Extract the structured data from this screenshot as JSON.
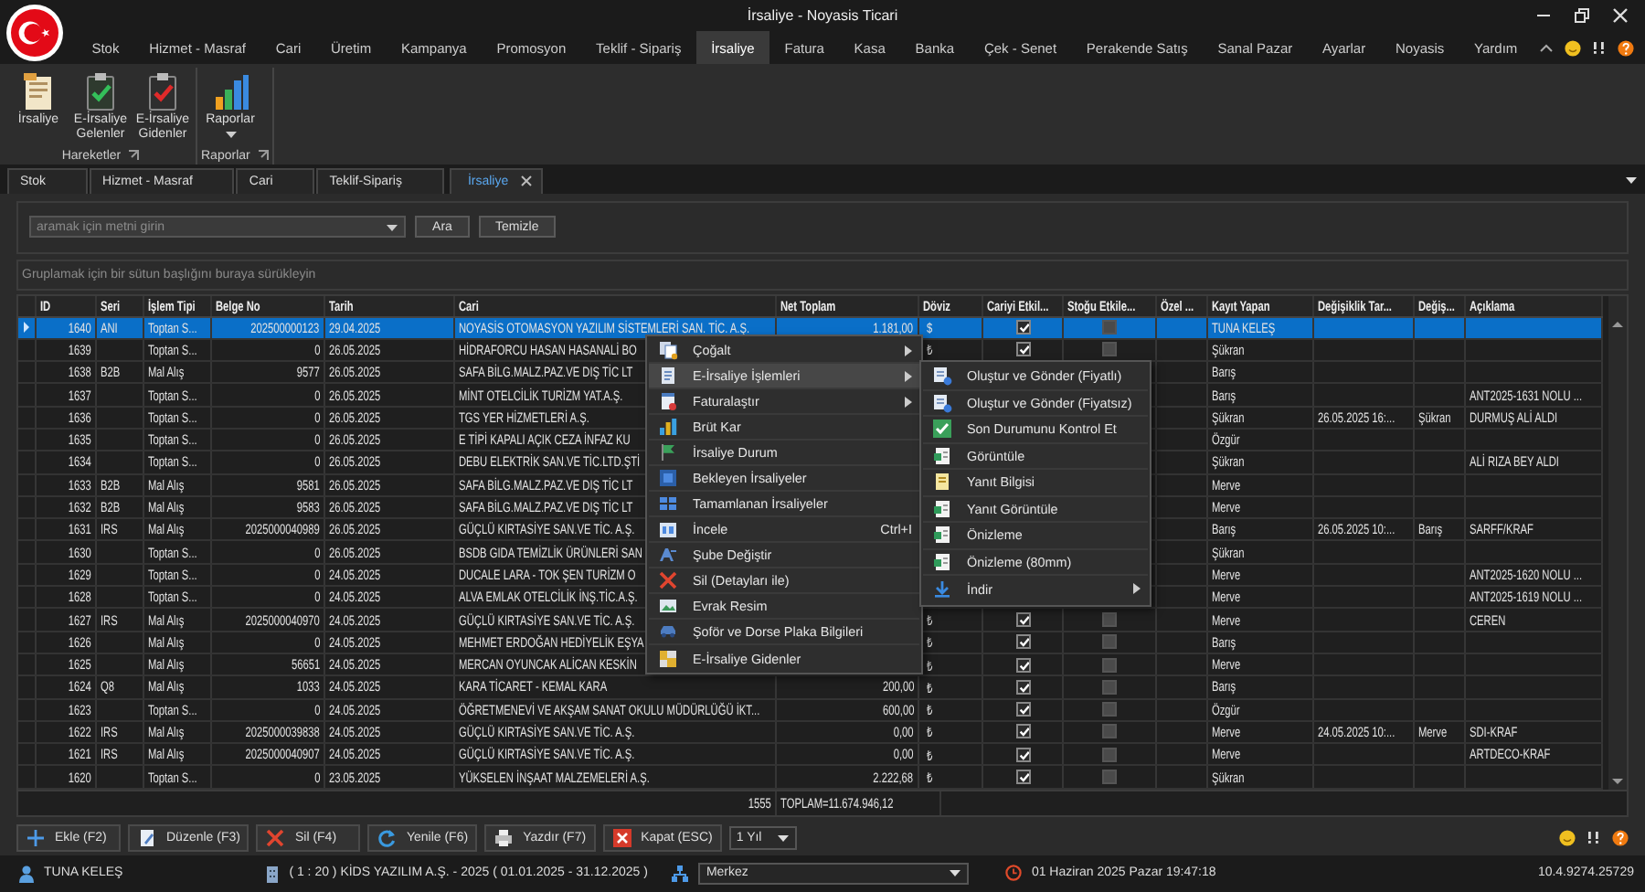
{
  "window": {
    "title": "İrsaliye - Noyasis Ticari"
  },
  "menu_tabs": [
    {
      "label": "Stok",
      "selected": false
    },
    {
      "label": "Hizmet - Masraf",
      "selected": false
    },
    {
      "label": "Cari",
      "selected": false
    },
    {
      "label": "Üretim",
      "selected": false
    },
    {
      "label": "Kampanya",
      "selected": false
    },
    {
      "label": "Promosyon",
      "selected": false
    },
    {
      "label": "Teklif - Sipariş",
      "selected": false
    },
    {
      "label": "İrsaliye",
      "selected": true
    },
    {
      "label": "Fatura",
      "selected": false
    },
    {
      "label": "Kasa",
      "selected": false
    },
    {
      "label": "Banka",
      "selected": false
    },
    {
      "label": "Çek - Senet",
      "selected": false
    },
    {
      "label": "Perakende Satış",
      "selected": false
    },
    {
      "label": "Sanal Pazar",
      "selected": false
    },
    {
      "label": "Ayarlar",
      "selected": false
    },
    {
      "label": "Noyasis",
      "selected": false
    },
    {
      "label": "Yardım",
      "selected": false
    }
  ],
  "ribbon": {
    "groups": [
      {
        "label": "Hareketler",
        "buttons": [
          {
            "label": "İrsaliye",
            "dropdown": false
          },
          {
            "label": "E-İrsaliye Gelenler",
            "dropdown": false
          },
          {
            "label": "E-İrsaliye Gidenler",
            "dropdown": false
          }
        ]
      },
      {
        "label": "Raporlar",
        "buttons": [
          {
            "label": "Raporlar",
            "dropdown": true
          }
        ]
      }
    ]
  },
  "doc_tabs": [
    {
      "label": "Stok",
      "selected": false,
      "closable": false
    },
    {
      "label": "Hizmet - Masraf",
      "selected": false,
      "closable": false
    },
    {
      "label": "Cari",
      "selected": false,
      "closable": false
    },
    {
      "label": "Teklif-Sipariş",
      "selected": false,
      "closable": false
    },
    {
      "label": "İrsaliye",
      "selected": true,
      "closable": true
    }
  ],
  "search": {
    "placeholder": "aramak için metni girin",
    "buttons": [
      "Ara",
      "Temizle"
    ]
  },
  "group_hint": "Gruplamak için bir sütun başlığını buraya sürükleyin",
  "grid": {
    "columns": [
      "ID",
      "Seri",
      "İşlem Tipi",
      "Belge No",
      "Tarih",
      "Cari",
      "Net Toplam",
      "Döviz",
      "Cariyi Etkil...",
      "Stoğu Etkile...",
      "Özel ...",
      "Kayıt Yapan",
      "Değişiklik Tar...",
      "Değiş...",
      "Açıklama"
    ],
    "rows": [
      {
        "selected": true,
        "id": "1640",
        "seri": "ANI",
        "islem_tipi": "Toptan S...",
        "belge_no": "202500000123",
        "tarih": "29.04.2025",
        "cari": "NOYASİS OTOMASYON YAZILIM SİSTEMLERİ SAN. TİC. A.Ş.",
        "net_toplam": "1.181,00",
        "doviz": "$",
        "cariyi_etkiler": true,
        "stogu_etkiler": false,
        "kayit_yapan": "TUNA KELEŞ"
      },
      {
        "selected": false,
        "id": "1639",
        "islem_tipi": "Toptan S...",
        "belge_no": "0",
        "tarih": "26.05.2025",
        "cari": "HİDRAFORCU HASAN HASANALİ BO",
        "doviz": "₺",
        "cariyi_etkiler": true,
        "stogu_etkiler": false,
        "kayit_yapan": "Şükran"
      },
      {
        "selected": false,
        "id": "1638",
        "seri": "B2B",
        "islem_tipi": "Mal Alış",
        "belge_no": "9577",
        "tarih": "26.05.2025",
        "cari": "SAFA BİLG.MALZ.PAZ.VE DIŞ TİC LT",
        "kayit_yapan": "Barış"
      },
      {
        "selected": false,
        "id": "1637",
        "islem_tipi": "Toptan S...",
        "belge_no": "0",
        "tarih": "26.05.2025",
        "cari": "MİNT OTELCİLİK TURİZM YAT.A.Ş.",
        "kayit_yapan": "Barış",
        "aciklama": "ANT2025-1631 NOLU ..."
      },
      {
        "selected": false,
        "id": "1636",
        "islem_tipi": "Toptan S...",
        "belge_no": "0",
        "tarih": "26.05.2025",
        "cari": "TGS YER HİZMETLERİ A.Ş.",
        "kayit_yapan": "Şükran",
        "degisiklik_tarihi": "26.05.2025 16:...",
        "degistiren": "Şükran",
        "aciklama": "DURMUŞ ALİ ALDI"
      },
      {
        "selected": false,
        "id": "1635",
        "islem_tipi": "Toptan S...",
        "belge_no": "0",
        "tarih": "26.05.2025",
        "cari": "E TİPİ KAPALI AÇIK CEZA İNFAZ KU",
        "kayit_yapan": "Özgür"
      },
      {
        "selected": false,
        "id": "1634",
        "islem_tipi": "Toptan S...",
        "belge_no": "0",
        "tarih": "26.05.2025",
        "cari": "DEBU ELEKTRİK SAN.VE TİC.LTD.ŞTİ",
        "kayit_yapan": "Şükran",
        "aciklama": "ALİ RIZA BEY ALDI"
      },
      {
        "selected": false,
        "id": "1633",
        "seri": "B2B",
        "islem_tipi": "Mal Alış",
        "belge_no": "9581",
        "tarih": "26.05.2025",
        "cari": "SAFA BİLG.MALZ.PAZ.VE DIŞ TİC LT",
        "kayit_yapan": "Merve"
      },
      {
        "selected": false,
        "id": "1632",
        "seri": "B2B",
        "islem_tipi": "Mal Alış",
        "belge_no": "9583",
        "tarih": "26.05.2025",
        "cari": "SAFA BİLG.MALZ.PAZ.VE DIŞ TİC LT",
        "kayit_yapan": "Merve"
      },
      {
        "selected": false,
        "id": "1631",
        "seri": "IRS",
        "islem_tipi": "Mal Alış",
        "belge_no": "2025000040989",
        "tarih": "26.05.2025",
        "cari": "GÜÇLÜ KIRTASİYE SAN.VE TİC. A.Ş.",
        "kayit_yapan": "Barış",
        "degisiklik_tarihi": "26.05.2025 10:...",
        "degistiren": "Barış",
        "aciklama": "SARFF/KRAF"
      },
      {
        "selected": false,
        "id": "1630",
        "islem_tipi": "Toptan S...",
        "belge_no": "0",
        "tarih": "26.05.2025",
        "cari": "BSDB GIDA TEMİZLİK ÜRÜNLERİ SAN",
        "kayit_yapan": "Şükran"
      },
      {
        "selected": false,
        "id": "1629",
        "islem_tipi": "Toptan S...",
        "belge_no": "0",
        "tarih": "24.05.2025",
        "cari": "DUCALE LARA - TOK ŞEN TURİZM O",
        "kayit_yapan": "Merve",
        "aciklama": "ANT2025-1620 NOLU ..."
      },
      {
        "selected": false,
        "id": "1628",
        "islem_tipi": "Toptan S...",
        "belge_no": "0",
        "tarih": "24.05.2025",
        "cari": "ALVA EMLAK OTELCİLİK İNŞ.TİC.A.Ş.",
        "kayit_yapan": "Merve",
        "aciklama": "ANT2025-1619 NOLU ..."
      },
      {
        "selected": false,
        "id": "1627",
        "seri": "IRS",
        "islem_tipi": "Mal Alış",
        "belge_no": "2025000040970",
        "tarih": "24.05.2025",
        "cari": "GÜÇLÜ KIRTASİYE SAN.VE TİC. A.Ş.",
        "doviz": "₺",
        "cariyi_etkiler": true,
        "stogu_etkiler": false,
        "kayit_yapan": "Merve",
        "aciklama": "CEREN"
      },
      {
        "selected": false,
        "id": "1626",
        "islem_tipi": "Mal Alış",
        "belge_no": "0",
        "tarih": "24.05.2025",
        "cari": "MEHMET ERDOĞAN HEDİYELİK EŞYA",
        "doviz": "₺",
        "cariyi_etkiler": true,
        "stogu_etkiler": false,
        "kayit_yapan": "Barış"
      },
      {
        "selected": false,
        "id": "1625",
        "islem_tipi": "Mal Alış",
        "belge_no": "56651",
        "tarih": "24.05.2025",
        "cari": "MERCAN OYUNCAK ALİCAN KESKİN",
        "doviz": "₺",
        "cariyi_etkiler": true,
        "stogu_etkiler": false,
        "kayit_yapan": "Merve"
      },
      {
        "selected": false,
        "id": "1624",
        "seri": "Q8",
        "islem_tipi": "Mal Alış",
        "belge_no": "1033",
        "tarih": "24.05.2025",
        "cari": "KARA TİCARET - KEMAL KARA",
        "net_toplam": "200,00",
        "doviz": "₺",
        "cariyi_etkiler": true,
        "stogu_etkiler": false,
        "kayit_yapan": "Barış"
      },
      {
        "selected": false,
        "id": "1623",
        "islem_tipi": "Toptan S...",
        "belge_no": "0",
        "tarih": "24.05.2025",
        "cari": "ÖĞRETMENEVİ VE AKŞAM SANAT OKULU MÜDÜRLÜĞÜ İKT...",
        "net_toplam": "600,00",
        "doviz": "₺",
        "cariyi_etkiler": true,
        "stogu_etkiler": false,
        "kayit_yapan": "Özgür"
      },
      {
        "selected": false,
        "id": "1622",
        "seri": "IRS",
        "islem_tipi": "Mal Alış",
        "belge_no": "2025000039838",
        "tarih": "24.05.2025",
        "cari": "GÜÇLÜ KIRTASİYE SAN.VE TİC. A.Ş.",
        "net_toplam": "0,00",
        "doviz": "₺",
        "cariyi_etkiler": true,
        "stogu_etkiler": false,
        "kayit_yapan": "Merve",
        "degisiklik_tarihi": "24.05.2025 10:...",
        "degistiren": "Merve",
        "aciklama": "SDI-KRAF"
      },
      {
        "selected": false,
        "id": "1621",
        "seri": "IRS",
        "islem_tipi": "Mal Alış",
        "belge_no": "2025000040907",
        "tarih": "24.05.2025",
        "cari": "GÜÇLÜ KIRTASİYE SAN.VE TİC. A.Ş.",
        "net_toplam": "0,00",
        "doviz": "₺",
        "cariyi_etkiler": true,
        "stogu_etkiler": false,
        "kayit_yapan": "Merve",
        "aciklama": "ARTDECO-KRAF"
      },
      {
        "selected": false,
        "id": "1620",
        "islem_tipi": "Toptan S...",
        "belge_no": "0",
        "tarih": "23.05.2025",
        "cari": "YÜKSELEN  İNŞAAT MALZEMELERİ A.Ş.",
        "net_toplam": "2.222,68",
        "doviz": "₺",
        "cariyi_etkiler": true,
        "stogu_etkiler": false,
        "kayit_yapan": "Şükran"
      }
    ],
    "footer": {
      "count": "1555",
      "total": "TOPLAM=11.674.946,12"
    }
  },
  "context_menu": {
    "items": [
      {
        "label": "Çoğalt",
        "submenu": true,
        "selected": false
      },
      {
        "label": "E-İrsaliye İşlemleri",
        "submenu": true,
        "selected": true
      },
      {
        "label": "Faturalaştır",
        "submenu": true,
        "selected": false
      },
      {
        "label": "Brüt Kar",
        "submenu": false,
        "selected": false
      },
      {
        "label": "İrsaliye Durum",
        "submenu": false,
        "selected": false
      },
      {
        "label": "Bekleyen İrsaliyeler",
        "submenu": false,
        "selected": false
      },
      {
        "label": "Tamamlanan İrsaliyeler",
        "submenu": false,
        "selected": false
      },
      {
        "label": "İncele",
        "submenu": false,
        "selected": false,
        "shortcut": "Ctrl+I"
      },
      {
        "label": "Şube Değiştir",
        "submenu": false,
        "selected": false
      },
      {
        "label": "Sil (Detayları ile)",
        "submenu": false,
        "selected": false
      },
      {
        "label": "Evrak Resim",
        "submenu": false,
        "selected": false
      },
      {
        "label": "Şoför ve Dorse Plaka Bilgileri",
        "submenu": false,
        "selected": false
      },
      {
        "label": "E-İrsaliye Gidenler",
        "submenu": false,
        "selected": false
      }
    ]
  },
  "submenu": {
    "items": [
      {
        "label": "Oluştur ve Gönder (Fiyatlı)",
        "submenu": false
      },
      {
        "label": "Oluştur ve Gönder (Fiyatsız)",
        "submenu": false
      },
      {
        "label": "Son Durumunu Kontrol Et",
        "submenu": false
      },
      {
        "label": "Görüntüle",
        "submenu": false
      },
      {
        "label": "Yanıt Bilgisi",
        "submenu": false
      },
      {
        "label": "Yanıt Görüntüle",
        "submenu": false
      },
      {
        "label": "Önizleme",
        "submenu": false
      },
      {
        "label": "Önizleme (80mm)",
        "submenu": false
      },
      {
        "label": "İndir",
        "submenu": true
      }
    ]
  },
  "actions": {
    "buttons": [
      "Ekle (F2)",
      "Düzenle (F3)",
      "Sil (F4)",
      "Yenile (F6)",
      "Yazdır (F7)",
      "Kapat (ESC)"
    ],
    "period": "1 Yıl"
  },
  "status_bar": {
    "user": "TUNA KELEŞ",
    "company": "( 1 : 20 ) KİDS YAZILIM A.Ş. - 2025 ( 01.01.2025 - 31.12.2025 )",
    "branch": "Merkez",
    "datetime": "01 Haziran 2025 Pazar 19:47:18",
    "version": "10.4.9274.25729"
  }
}
